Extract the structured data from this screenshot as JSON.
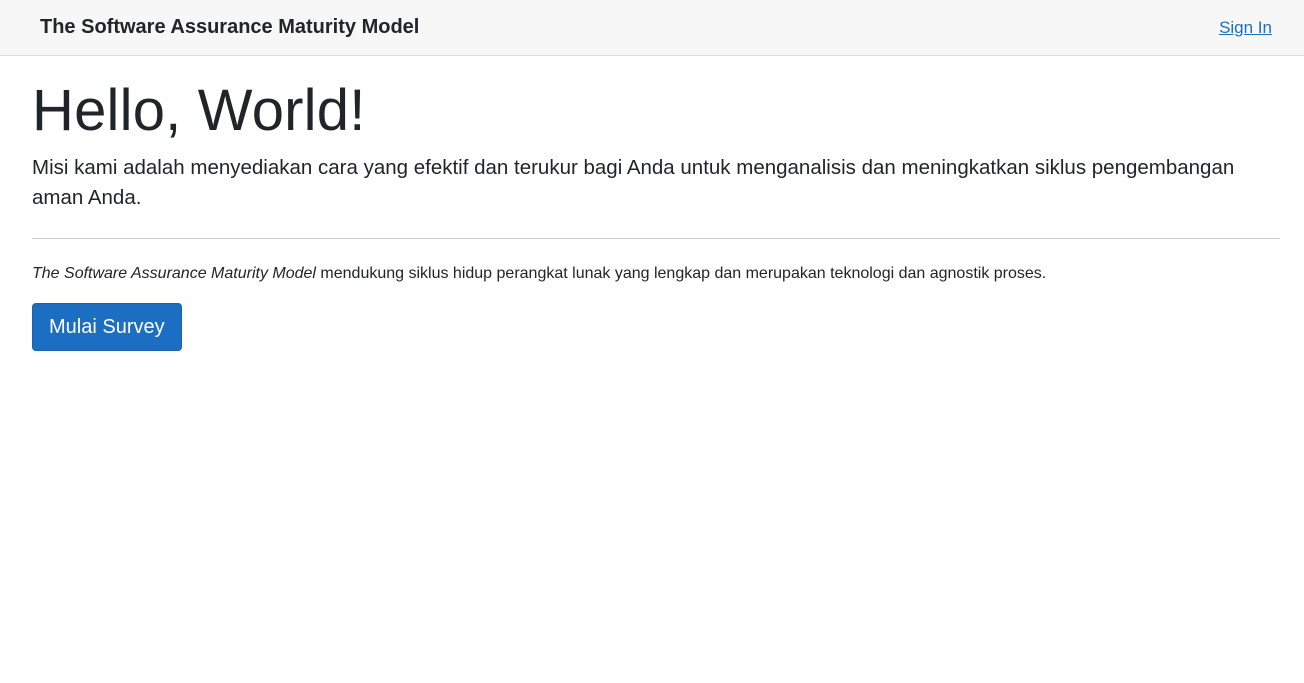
{
  "navbar": {
    "brand": "The Software Assurance Maturity Model",
    "signin_label": "Sign In"
  },
  "hero": {
    "title": "Hello, World!",
    "lead": "Misi kami adalah menyediakan cara yang efektif dan terukur bagi Anda untuk menganalisis dan meningkatkan siklus pengembangan aman Anda."
  },
  "description": {
    "emphasis": "The Software Assurance Maturity Model",
    "rest": " mendukung siklus hidup perangkat lunak yang lengkap dan merupakan teknologi dan agnostik proses."
  },
  "actions": {
    "start_survey_label": "Mulai Survey"
  },
  "colors": {
    "primary": "#1b6ec2",
    "navbar_bg": "#f7f7f7",
    "text": "#212529"
  }
}
